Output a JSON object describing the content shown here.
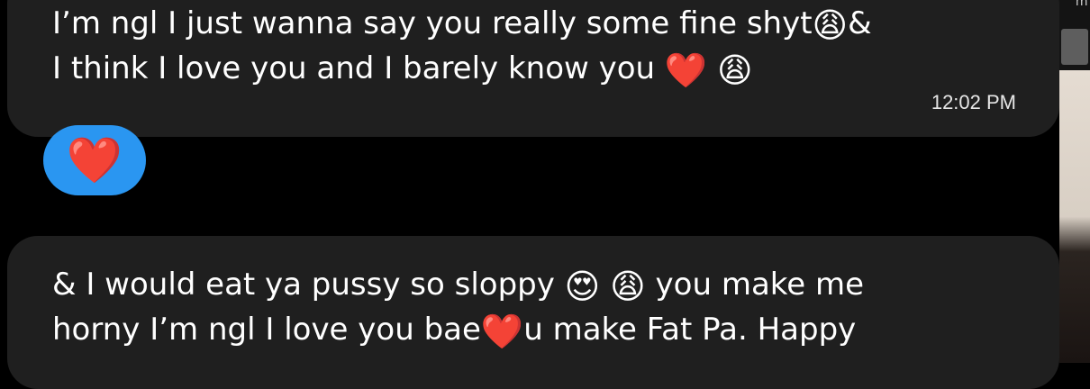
{
  "background": {
    "top_right_text": "'m"
  },
  "messages": [
    {
      "lines": [
        [
          "I’m ngl I just wanna say you really some fine shyt",
          "😩",
          "&"
        ],
        [
          "I think I love you and I barely know you ",
          "❤️",
          " ",
          "😩"
        ]
      ],
      "time": "12:02 PM",
      "reaction": "❤️"
    },
    {
      "lines": [
        [
          "& I would eat ya pussy so sloppy ",
          "😍",
          " ",
          "😩",
          " you make me"
        ],
        [
          "horny I’m ngl I love you bae",
          "❤️",
          "u make Fat Pa. Happy"
        ]
      ]
    }
  ],
  "colors": {
    "bubble": "#1f1f1f",
    "reaction_bg": "#2a96f1",
    "text": "#ffffff"
  }
}
